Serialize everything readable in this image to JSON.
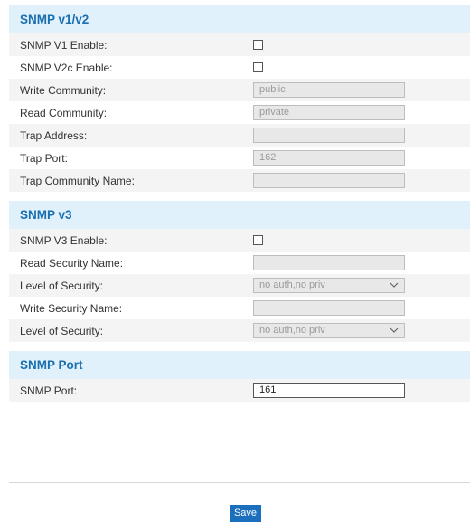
{
  "sections": {
    "v1v2": {
      "title": "SNMP v1/v2",
      "v1_enable_label": "SNMP V1 Enable:",
      "v2c_enable_label": "SNMP V2c Enable:",
      "write_community_label": "Write Community:",
      "write_community_value": "public",
      "read_community_label": "Read Community:",
      "read_community_value": "private",
      "trap_address_label": "Trap Address:",
      "trap_address_value": "",
      "trap_port_label": "Trap Port:",
      "trap_port_value": "162",
      "trap_community_label": "Trap Community Name:",
      "trap_community_value": ""
    },
    "v3": {
      "title": "SNMP v3",
      "v3_enable_label": "SNMP V3 Enable:",
      "read_security_label": "Read Security Name:",
      "read_security_value": "",
      "read_level_label": "Level of Security:",
      "read_level_value": "no auth,no priv",
      "write_security_label": "Write Security Name:",
      "write_security_value": "",
      "write_level_label": "Level of Security:",
      "write_level_value": "no auth,no priv"
    },
    "port": {
      "title": "SNMP Port",
      "port_label": "SNMP Port:",
      "port_value": "161"
    }
  },
  "save_label": "Save",
  "colors": {
    "header_bg": "#e1f1fb",
    "header_text": "#1a6fb0",
    "button_bg": "#1b6fbd"
  },
  "icons": {
    "dropdown": "chevron-down-icon"
  }
}
